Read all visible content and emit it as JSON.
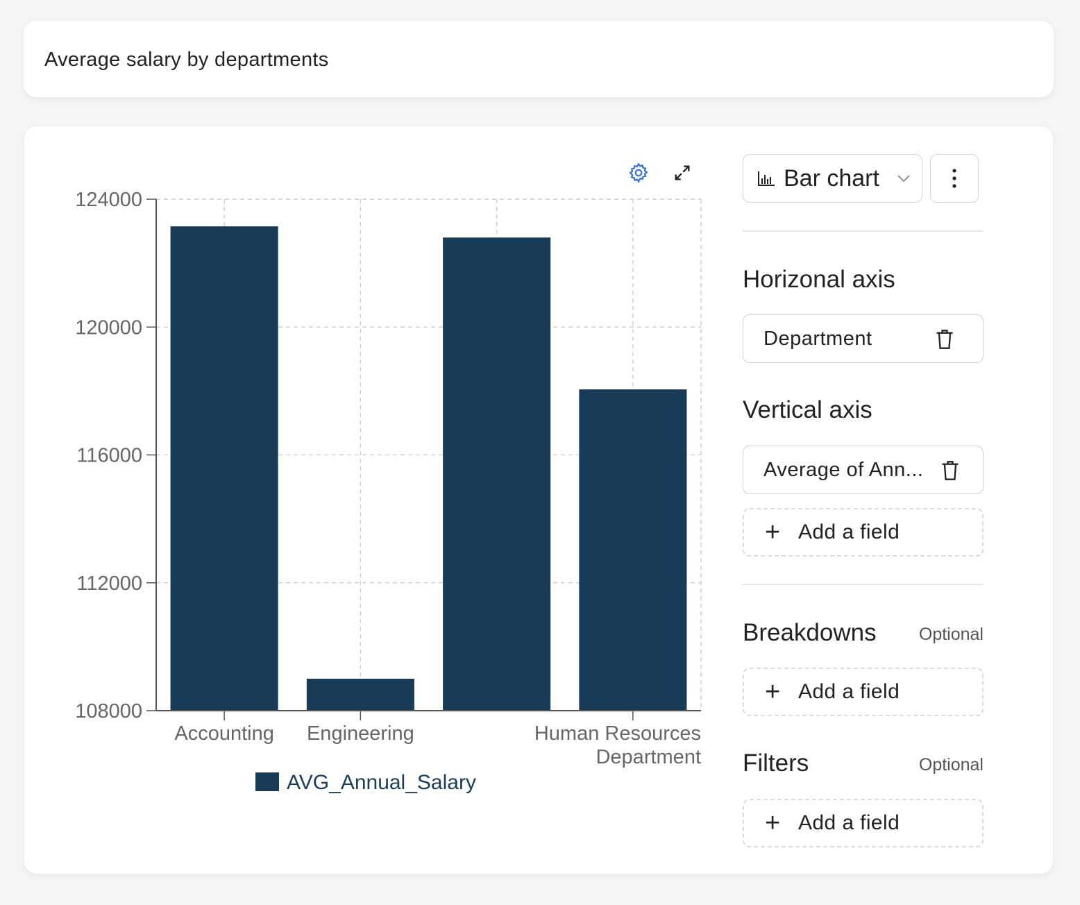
{
  "title": "Average salary by departments",
  "chart_data": {
    "type": "bar",
    "categories": [
      "Accounting",
      "Engineering",
      "",
      "Human Resources"
    ],
    "y_ticks": [
      108000,
      112000,
      116000,
      120000,
      124000
    ],
    "ylim": [
      108000,
      124000
    ],
    "series": [
      {
        "name": "AVG_Annual_Salary",
        "color": "#183c58",
        "values": [
          123150,
          109000,
          122800,
          118050
        ]
      }
    ],
    "xlabel": "Department",
    "legend": "AVG_Annual_Salary",
    "grid": true,
    "legend_placement": "bottom-center"
  },
  "toolbar": {
    "settings_icon": "gear-icon",
    "expand_icon": "expand-icon"
  },
  "panel": {
    "chart_type_label": "Bar chart",
    "horizontal_title": "Horizonal axis",
    "horizontal_field": "Department",
    "vertical_title": "Vertical axis",
    "vertical_field": "Average of Ann...",
    "add_field_label": "Add a field",
    "breakdowns_title": "Breakdowns",
    "filters_title": "Filters",
    "optional_label": "Optional"
  },
  "colors": {
    "bar": "#183c58",
    "accent": "#2f6fe0"
  }
}
